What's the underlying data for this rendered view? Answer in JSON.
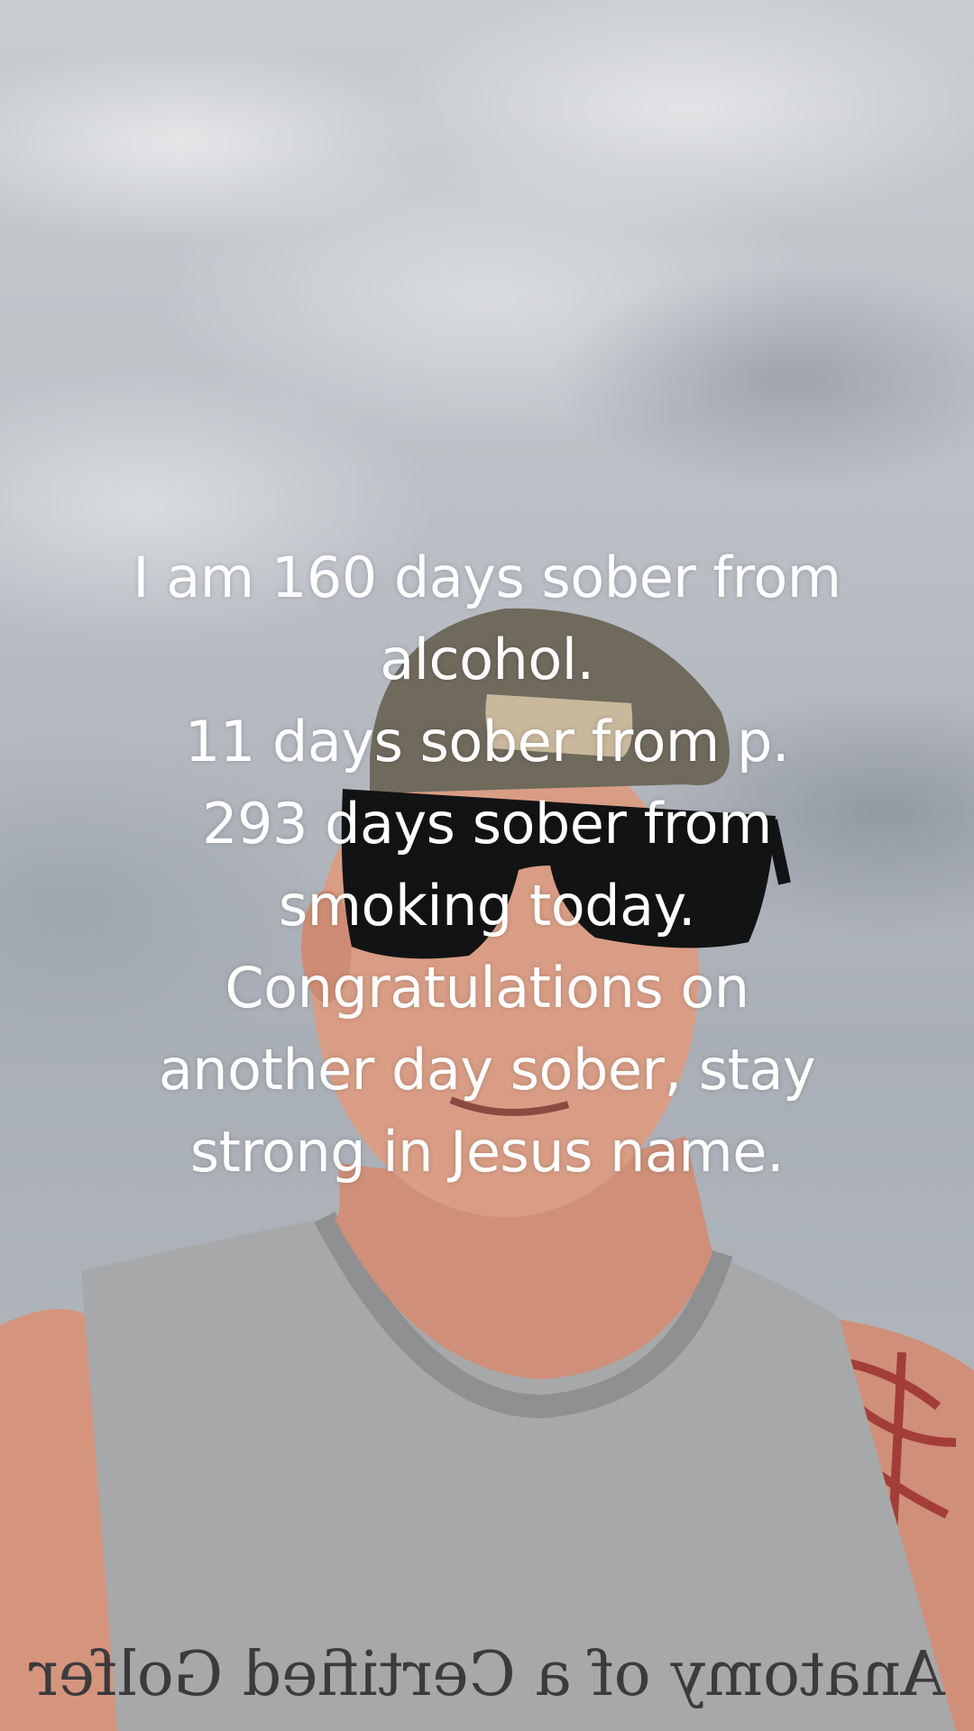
{
  "caption": {
    "lines": [
      "I am 160 days sober from",
      "alcohol.",
      "11 days sober from p.",
      "293 days sober from",
      "smoking today.",
      "Congratulations on",
      "another day sober, stay",
      "strong in Jesus name."
    ]
  },
  "shirt": {
    "print_text": "Anatomy of a Certified Golfer"
  },
  "colors": {
    "sky": "#b8bdc3",
    "shirt": "#a9a9aa",
    "skin": "#d89a82",
    "caption_text": "#ffffff"
  }
}
